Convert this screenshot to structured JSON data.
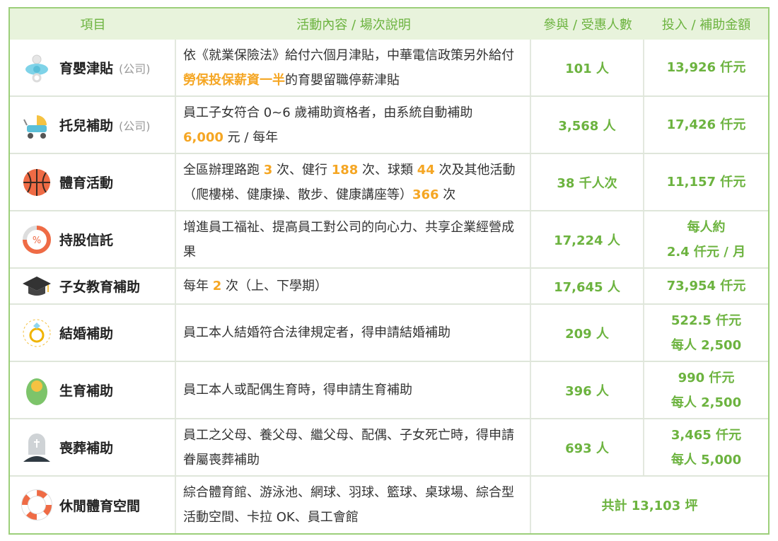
{
  "header": {
    "col_item": "項目",
    "col_desc": "活動內容 / 場次說明",
    "col_count": "參與 / 受惠人數",
    "col_amount": "投入 / 補助金額"
  },
  "colors": {
    "accent": "#6cb33f",
    "highlight": "#f5a623"
  },
  "rows": [
    {
      "icon": "pacifier-icon",
      "name": "育嬰津貼",
      "note": "(公司)",
      "desc_parts": [
        "依《就業保險法》給付六個月津貼，中華電信政策另外給付",
        "勞保投保薪資一半",
        "的育嬰留職停薪津貼"
      ],
      "count": "101 人",
      "amount1": "13,926 仟元",
      "amount2": ""
    },
    {
      "icon": "stroller-icon",
      "name": "托兒補助",
      "note": "(公司)",
      "desc_parts": [
        "員工子女符合 0~6 歲補助資格者，由系統自動補助",
        "6,000",
        " 元 / 每年"
      ],
      "count": "3,568 人",
      "amount1": "17,426 仟元",
      "amount2": ""
    },
    {
      "icon": "basketball-icon",
      "name": "體育活動",
      "note": "",
      "desc_parts": [
        "全區辦理路跑 ",
        "3",
        " 次、健行 ",
        "188",
        " 次、球類 ",
        "44",
        " 次及其他活動（爬樓梯、健康操、散步、健康講座等）",
        "366",
        " 次"
      ],
      "count": "38 千人次",
      "amount1": "11,157 仟元",
      "amount2": ""
    },
    {
      "icon": "percent-ring-icon",
      "name": "持股信託",
      "note": "",
      "desc_parts": [
        "增進員工福祉、提高員工對公司的向心力、共享企業經營成果"
      ],
      "count": "17,224 人",
      "amount1": "每人約",
      "amount2": "2.4 仟元 / 月"
    },
    {
      "icon": "graduation-cap-icon",
      "name": "子女教育補助",
      "note": "",
      "desc_parts": [
        "每年 ",
        "2",
        " 次（上、下學期）"
      ],
      "count": "17,645 人",
      "amount1": "73,954 仟元",
      "amount2": ""
    },
    {
      "icon": "ring-icon",
      "name": "結婚補助",
      "note": "",
      "desc_parts": [
        "員工本人結婚符合法律規定者，得申請結婚補助"
      ],
      "count": "209 人",
      "amount1": "522.5 仟元",
      "amount2": "每人 2,500"
    },
    {
      "icon": "baby-icon",
      "name": "生育補助",
      "note": "",
      "desc_parts": [
        "員工本人或配偶生育時，得申請生育補助"
      ],
      "count": "396 人",
      "amount1": "990 仟元",
      "amount2": "每人 2,500"
    },
    {
      "icon": "tombstone-icon",
      "name": "喪葬補助",
      "note": "",
      "desc_parts": [
        "員工之父母、養父母、繼父母、配偶、子女死亡時，得申請眷屬喪葬補助"
      ],
      "count": "693 人",
      "amount1": "3,465 仟元",
      "amount2": "每人 5,000"
    },
    {
      "icon": "lifebuoy-icon",
      "name": "休閒體育空間",
      "note": "",
      "desc_parts": [
        "綜合體育館、游泳池、網球、羽球、籃球、桌球場、綜合型活動空間、卡拉 OK、員工會館"
      ],
      "merged": "共計 13,103 坪"
    }
  ]
}
